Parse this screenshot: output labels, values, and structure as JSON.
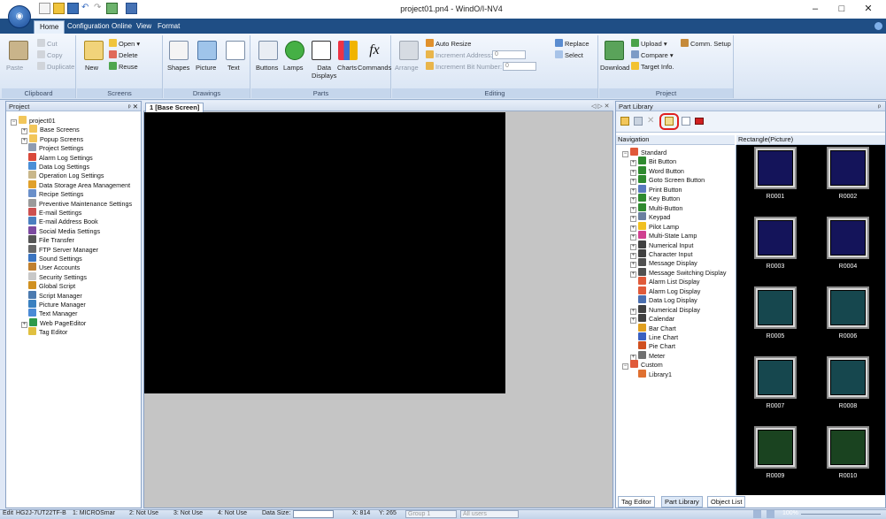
{
  "window": {
    "title": "project01.pn4 - WindO/I-NV4",
    "minimize": "–",
    "maximize": "□",
    "close": "✕"
  },
  "menu_tabs": [
    "Home",
    "Configuration",
    "Online",
    "View",
    "Format"
  ],
  "ribbon": {
    "clipboard": {
      "label": "Clipboard",
      "paste": "Paste",
      "cut": "Cut",
      "copy": "Copy",
      "duplicate": "Duplicate"
    },
    "screens": {
      "label": "Screens",
      "new": "New",
      "open": "Open ▾",
      "delete": "Delete",
      "reuse": "Reuse"
    },
    "drawings": {
      "label": "Drawings",
      "shapes": "Shapes",
      "picture": "Picture",
      "text": "Text"
    },
    "parts": {
      "label": "Parts",
      "buttons": "Buttons",
      "lamps": "Lamps",
      "data_displays_1": "Data",
      "data_displays_2": "Displays",
      "charts": "Charts",
      "commands": "Commands"
    },
    "editing": {
      "label": "Editing",
      "arrange": "Arrange",
      "auto_resize": "Auto Resize",
      "increment_address": "Increment Address:",
      "increment_address_val": "0",
      "increment_bit": "Increment Bit Number:",
      "increment_bit_val": "0",
      "replace": "Replace",
      "select": "Select"
    },
    "project": {
      "label": "Project",
      "download": "Download",
      "upload": "Upload ▾",
      "comm_setup": "Comm. Setup",
      "compare": "Compare ▾",
      "target_info": "Target Info."
    }
  },
  "project_panel": {
    "title": "Project",
    "pin": "ᵖ ✕",
    "items": [
      {
        "label": "project01"
      },
      {
        "label": "Base Screens"
      },
      {
        "label": "Popup Screens"
      },
      {
        "label": "Project Settings"
      },
      {
        "label": "Alarm Log Settings"
      },
      {
        "label": "Data Log Settings"
      },
      {
        "label": "Operation Log Settings"
      },
      {
        "label": "Data Storage Area Management"
      },
      {
        "label": "Recipe Settings"
      },
      {
        "label": "Preventive Maintenance Settings"
      },
      {
        "label": "E-mail Settings"
      },
      {
        "label": "E-mail Address Book"
      },
      {
        "label": "Social Media Settings"
      },
      {
        "label": "File Transfer"
      },
      {
        "label": "FTP Server Manager"
      },
      {
        "label": "Sound Settings"
      },
      {
        "label": "User Accounts"
      },
      {
        "label": "Security Settings"
      },
      {
        "label": "Global Script"
      },
      {
        "label": "Script Manager"
      },
      {
        "label": "Picture Manager"
      },
      {
        "label": "Text Manager"
      },
      {
        "label": "Web PageEditor"
      },
      {
        "label": "Tag Editor"
      }
    ]
  },
  "editor": {
    "tab": "1 [Base Screen]",
    "nav": "◁ ▷ ✕"
  },
  "part_library": {
    "title": "Part Library",
    "pin": "ᵖ",
    "navigation_label": "Navigation",
    "preview_label": "Rectangle(Picture)",
    "nav_items": [
      {
        "label": "Standard"
      },
      {
        "label": "Bit Button"
      },
      {
        "label": "Word Button"
      },
      {
        "label": "Goto Screen Button"
      },
      {
        "label": "Print Button"
      },
      {
        "label": "Key Button"
      },
      {
        "label": "Multi-Button"
      },
      {
        "label": "Keypad"
      },
      {
        "label": "Pilot Lamp"
      },
      {
        "label": "Multi-State Lamp"
      },
      {
        "label": "Numerical Input"
      },
      {
        "label": "Character Input"
      },
      {
        "label": "Message Display"
      },
      {
        "label": "Message Switching Display"
      },
      {
        "label": "Alarm List Display"
      },
      {
        "label": "Alarm Log Display"
      },
      {
        "label": "Data Log Display"
      },
      {
        "label": "Numerical Display"
      },
      {
        "label": "Calendar"
      },
      {
        "label": "Bar Chart"
      },
      {
        "label": "Line Chart"
      },
      {
        "label": "Pie Chart"
      },
      {
        "label": "Meter"
      },
      {
        "label": "Custom"
      },
      {
        "label": "Library1"
      }
    ],
    "thumbs": [
      {
        "name": "R0001",
        "color": "#14145a"
      },
      {
        "name": "R0002",
        "color": "#14145a"
      },
      {
        "name": "R0003",
        "color": "#14145a"
      },
      {
        "name": "R0004",
        "color": "#14145a"
      },
      {
        "name": "R0005",
        "color": "#16474e"
      },
      {
        "name": "R0006",
        "color": "#16474e"
      },
      {
        "name": "R0007",
        "color": "#16474e"
      },
      {
        "name": "R0008",
        "color": "#16474e"
      },
      {
        "name": "R0009",
        "color": "#1a4320"
      },
      {
        "name": "R0010",
        "color": "#1a4320"
      }
    ],
    "bottom_tabs": [
      "Tag Editor",
      "Part Library",
      "Object List"
    ]
  },
  "status": {
    "edit": "Edit",
    "hg": "HG2J-7UT22TF-B",
    "link1": "1: MICROSmar",
    "link2": "2: Not Use",
    "link3": "3: Not Use",
    "link4": "4: Not Use",
    "data_size": "Data Size:",
    "x": "X: 814",
    "y": "Y: 265",
    "group": "Group 1",
    "users": "All users",
    "zoom": "100%"
  },
  "colors": {
    "accent": "#1f4e85",
    "highlight": "#e02020"
  }
}
